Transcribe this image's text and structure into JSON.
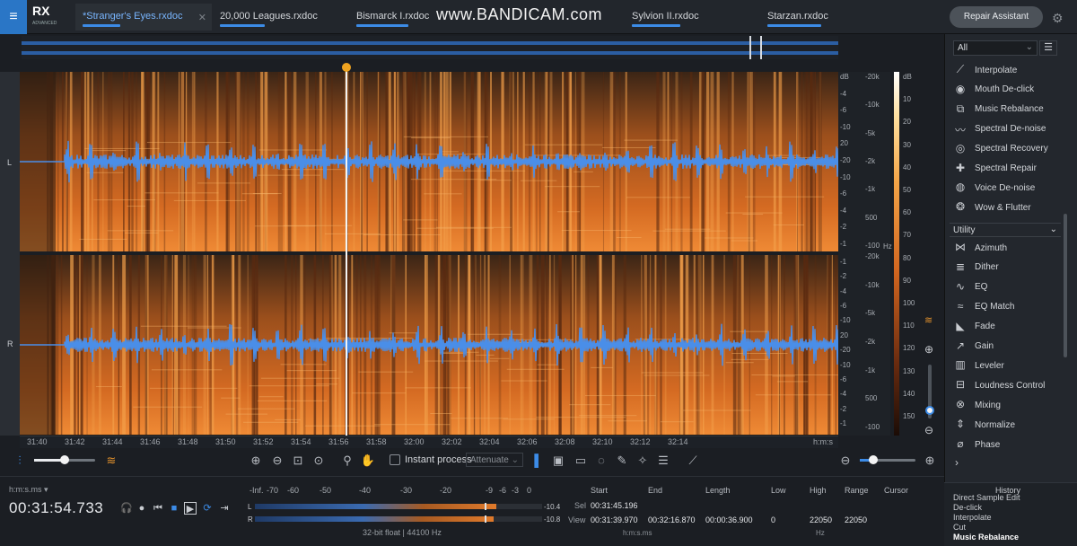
{
  "app": {
    "logo": "RX",
    "logo_sub": "ADVANCED"
  },
  "tabs": [
    {
      "label": "*Stranger's Eyes.rxdoc",
      "active": true
    },
    {
      "label": "20,000 Leagues.rxdoc",
      "active": false
    },
    {
      "label": "Bismarck I.rxdoc",
      "active": false
    },
    {
      "label": "Sylvion II.rxdoc",
      "active": false
    },
    {
      "label": "Starzan.rxdoc",
      "active": false
    }
  ],
  "watermark": "www.BANDICAM.com",
  "repair_assistant": "Repair Assistant",
  "channels": {
    "left": "L",
    "right": "R"
  },
  "db_scale_top": [
    "dB",
    "-4",
    "-6",
    "-10",
    "20",
    "-20",
    "-10",
    "-6",
    "-4",
    "-2",
    "-1"
  ],
  "db_scale_bottom": [
    "-1",
    "-2",
    "-4",
    "-6",
    "-10",
    "20",
    "-20",
    "-10",
    "-6",
    "-4",
    "-2",
    "-1"
  ],
  "hz_scale_top": [
    "-20k",
    "-10k",
    "-5k",
    "-2k",
    "-1k",
    "500",
    "-100"
  ],
  "hz_scale_bottom": [
    "-20k",
    "-10k",
    "-5k",
    "-2k",
    "-1k",
    "500",
    "-100"
  ],
  "hz_unit": "Hz",
  "intensity_scale": [
    "dB",
    "10",
    "20",
    "30",
    "40",
    "50",
    "60",
    "70",
    "80",
    "90",
    "100",
    "110",
    "120",
    "130",
    "140",
    "150"
  ],
  "ruler": {
    "labels": [
      "31:40",
      "31:42",
      "31:44",
      "31:46",
      "31:48",
      "31:50",
      "31:52",
      "31:54",
      "31:56",
      "31:58",
      "32:00",
      "32:02",
      "32:04",
      "32:06",
      "32:08",
      "32:10",
      "32:12",
      "32:14"
    ],
    "unit": "h:m:s"
  },
  "toolbar": {
    "instant_process": "Instant process",
    "attenuate": "Attenuate"
  },
  "transport": {
    "format_label": "h:m:s.ms",
    "timecode": "00:31:54.733"
  },
  "meter": {
    "scale": [
      "-Inf.",
      "-70",
      "-60",
      "-50",
      "-40",
      "-30",
      "-20",
      "-9",
      "-6",
      "-3",
      "0"
    ],
    "left_label": "L",
    "right_label": "R",
    "left_peak": "-10.4",
    "right_peak": "-10.8",
    "left_level": 0.84,
    "right_level": 0.83,
    "format": "32-bit float | 44100 Hz"
  },
  "selection": {
    "headers": [
      "Start",
      "End",
      "Length",
      "Low",
      "High",
      "Range",
      "Cursor"
    ],
    "sel_label": "Sel",
    "view_label": "View",
    "sel_start": "00:31:45.196",
    "view_start": "00:31:39.970",
    "view_end": "00:32:16.870",
    "view_length": "00:00:36.900",
    "low": "0",
    "high": "22050",
    "range": "22050",
    "units_time": "h:m:s.ms",
    "units_freq": "Hz"
  },
  "panel": {
    "filter": "All",
    "modules_top": [
      {
        "label": "Interpolate",
        "icon": "interpolate-icon"
      },
      {
        "label": "Mouth De-click",
        "icon": "mouth-declick-icon"
      },
      {
        "label": "Music Rebalance",
        "icon": "music-rebalance-icon"
      },
      {
        "label": "Spectral De-noise",
        "icon": "spectral-denoise-icon"
      },
      {
        "label": "Spectral Recovery",
        "icon": "spectral-recovery-icon"
      },
      {
        "label": "Spectral Repair",
        "icon": "spectral-repair-icon"
      },
      {
        "label": "Voice De-noise",
        "icon": "voice-denoise-icon"
      },
      {
        "label": "Wow & Flutter",
        "icon": "wow-flutter-icon"
      }
    ],
    "utility_label": "Utility",
    "modules_utility": [
      {
        "label": "Azimuth",
        "icon": "azimuth-icon"
      },
      {
        "label": "Dither",
        "icon": "dither-icon"
      },
      {
        "label": "EQ",
        "icon": "eq-icon"
      },
      {
        "label": "EQ Match",
        "icon": "eq-match-icon"
      },
      {
        "label": "Fade",
        "icon": "fade-icon"
      },
      {
        "label": "Gain",
        "icon": "gain-icon"
      },
      {
        "label": "Leveler",
        "icon": "leveler-icon"
      },
      {
        "label": "Loudness Control",
        "icon": "loudness-control-icon"
      },
      {
        "label": "Mixing",
        "icon": "mixing-icon"
      },
      {
        "label": "Normalize",
        "icon": "normalize-icon"
      },
      {
        "label": "Phase",
        "icon": "phase-icon"
      }
    ]
  },
  "history": {
    "title": "History",
    "items": [
      "Direct Sample Edit",
      "De-click",
      "Interpolate",
      "Cut",
      "Music Rebalance"
    ]
  },
  "colors": {
    "accent": "#3c8be6",
    "waveform": "#4a8ee8",
    "spectrogram": "#e07a2b",
    "playhead_knob": "#f0a420"
  }
}
